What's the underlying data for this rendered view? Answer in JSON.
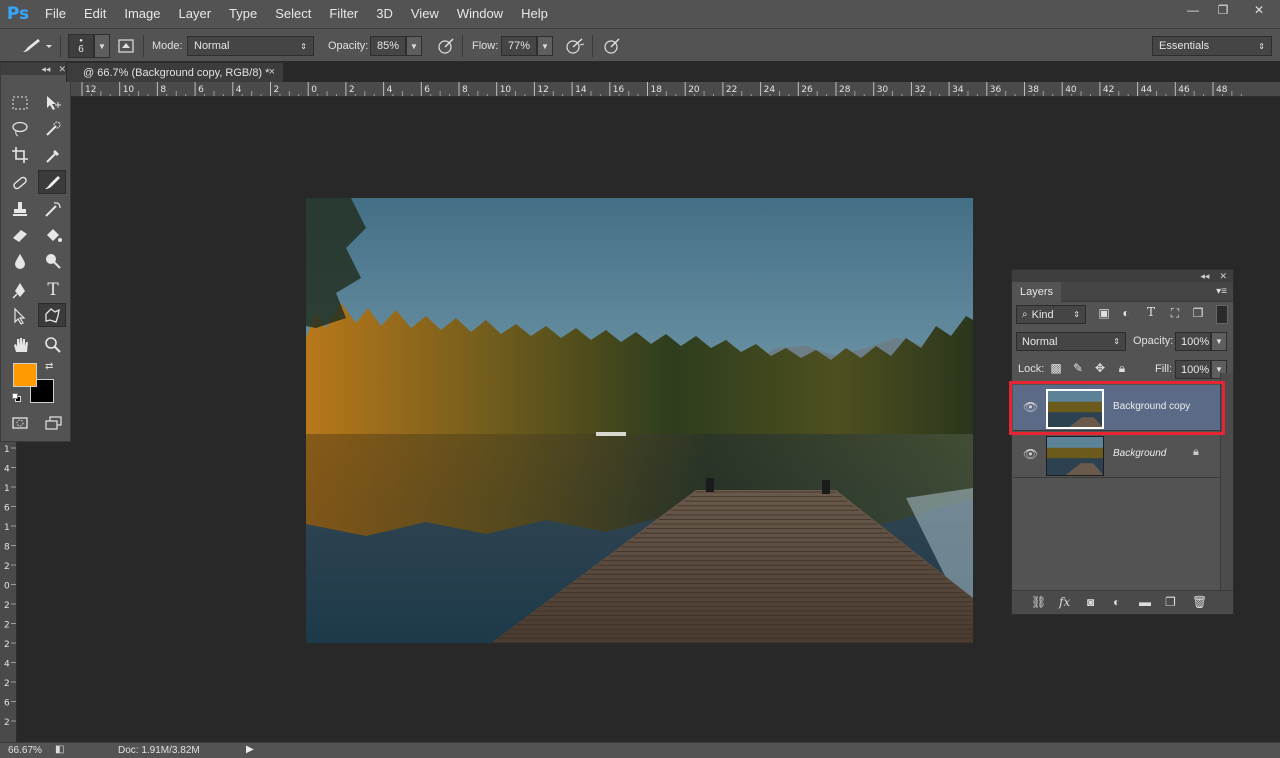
{
  "app": {
    "logo": "Ps",
    "menu": [
      "File",
      "Edit",
      "Image",
      "Layer",
      "Type",
      "Select",
      "Filter",
      "3D",
      "View",
      "Window",
      "Help"
    ],
    "window_controls": [
      "—",
      "❐",
      "✕"
    ]
  },
  "options_bar": {
    "brush_size": "6",
    "mode_label": "Mode:",
    "mode_value": "Normal",
    "opacity_label": "Opacity:",
    "opacity_value": "85%",
    "flow_label": "Flow:",
    "flow_value": "77%",
    "workspace": "Essentials"
  },
  "document": {
    "tab_title": "@ 66.7% (Background copy, RGB/8) *",
    "close": "×"
  },
  "ruler": {
    "top_labels": [
      "12",
      "10",
      "8",
      "6",
      "4",
      "2",
      "0",
      "2",
      "4",
      "6",
      "8",
      "10",
      "12",
      "14",
      "16",
      "18",
      "20",
      "22",
      "24",
      "26",
      "28",
      "30",
      "32",
      "34",
      "36",
      "38",
      "40",
      "42",
      "44",
      "46",
      "48"
    ],
    "left_labels": [
      "1",
      "4",
      "1",
      "6",
      "1",
      "8",
      "2",
      "0",
      "2",
      "2",
      "2",
      "4",
      "2",
      "6",
      "2"
    ]
  },
  "tools": {
    "rows": [
      [
        "marquee-tool",
        "move-tool"
      ],
      [
        "lasso-tool",
        "quick-selection-tool"
      ],
      [
        "crop-tool",
        "eyedropper-tool"
      ],
      [
        "healing-brush-tool",
        "brush-tool"
      ],
      [
        "clone-stamp-tool",
        "history-brush-tool"
      ],
      [
        "eraser-tool",
        "paint-bucket-tool"
      ],
      [
        "blur-tool",
        "dodge-tool"
      ],
      [
        "pen-tool",
        "type-tool"
      ],
      [
        "path-selection-tool",
        "custom-shape-tool"
      ],
      [
        "hand-tool",
        "zoom-tool"
      ]
    ],
    "foreground_color": "#ff9b00",
    "background_color": "#000000"
  },
  "status_bar": {
    "zoom": "66.67%",
    "doc_info": "Doc: 1.91M/3.82M"
  },
  "layers_panel": {
    "tab": "Layers",
    "filter_kind": "Kind",
    "blend_mode": "Normal",
    "opacity_label": "Opacity:",
    "opacity_value": "100%",
    "lock_label": "Lock:",
    "fill_label": "Fill:",
    "fill_value": "100%",
    "layers": [
      {
        "name": "Background copy",
        "selected": true
      },
      {
        "name": "Background",
        "locked": true
      }
    ],
    "highlight_color": "#e52531"
  }
}
